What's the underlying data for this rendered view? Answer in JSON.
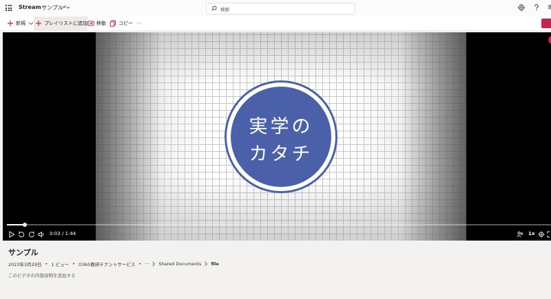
{
  "header": {
    "app_name": "Stream",
    "title": "サンプル",
    "search_placeholder": "検索",
    "avatar_stub": "青"
  },
  "commands": {
    "new_label": "新規",
    "add_playlist_label": "プレイリストに追加",
    "move_label": "移動",
    "copy_label": "コピー",
    "more_label": "···"
  },
  "video": {
    "logo_line1": "実学の",
    "logo_line2": "カタチ",
    "time": "0:03 / 1:44",
    "speed": "1x",
    "progress": 0.033,
    "colors": {
      "logo": "#4a61aa",
      "accent": "#c4254f"
    }
  },
  "details": {
    "title": "サンプル",
    "date": "2023年3月29日",
    "views": "1 ビュー",
    "owner": "O365教研テナントサービス",
    "ellipsis": "···",
    "crumb_folder": "Shared Documents",
    "crumb_file": "file",
    "description_placeholder": "このビデオの内容説明を追加する"
  }
}
